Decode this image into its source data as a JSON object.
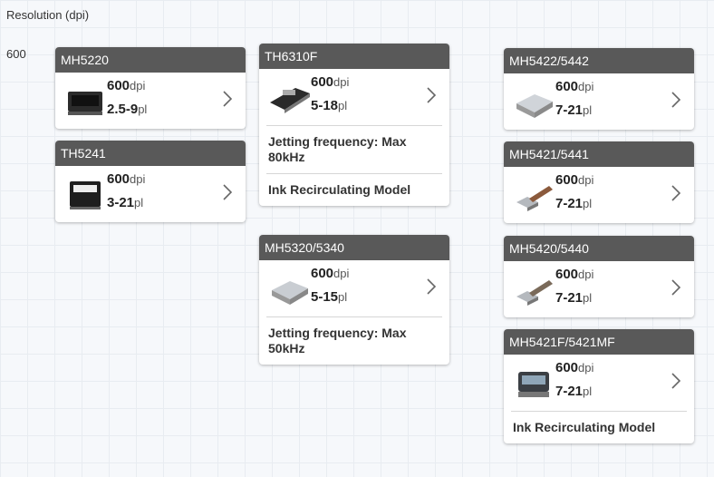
{
  "axis_title": "Resolution (dpi)",
  "row_label": "600",
  "cards": [
    {
      "model": "MH5220",
      "dpi": "600",
      "dpi_unit": "dpi",
      "drop": "2.5-9",
      "drop_unit": "pl",
      "icon": "printhead-black-icon",
      "features": []
    },
    {
      "model": "TH5241",
      "dpi": "600",
      "dpi_unit": "dpi",
      "drop": "3-21",
      "drop_unit": "pl",
      "icon": "printhead-box-icon",
      "features": []
    },
    {
      "model": "TH6310F",
      "dpi": "600",
      "dpi_unit": "dpi",
      "drop": "5-18",
      "drop_unit": "pl",
      "icon": "printhead-wide-icon",
      "features": [
        "Jetting frequency: Max 80kHz",
        "Ink Recirculating Model"
      ]
    },
    {
      "model": "MH5320/5340",
      "dpi": "600",
      "dpi_unit": "dpi",
      "drop": "5-15",
      "drop_unit": "pl",
      "icon": "printhead-silver-icon",
      "features": [
        "Jetting frequency: Max 50kHz"
      ]
    },
    {
      "model": "MH5422/5442",
      "dpi": "600",
      "dpi_unit": "dpi",
      "drop": "7-21",
      "drop_unit": "pl",
      "icon": "printhead-silver-icon",
      "features": []
    },
    {
      "model": "MH5421/5441",
      "dpi": "600",
      "dpi_unit": "dpi",
      "drop": "7-21",
      "drop_unit": "pl",
      "icon": "printhead-cable-icon",
      "features": []
    },
    {
      "model": "MH5420/5440",
      "dpi": "600",
      "dpi_unit": "dpi",
      "drop": "7-21",
      "drop_unit": "pl",
      "icon": "printhead-cable-icon",
      "features": []
    },
    {
      "model": "MH5421F/5421MF",
      "dpi": "600",
      "dpi_unit": "dpi",
      "drop": "7-21",
      "drop_unit": "pl",
      "icon": "printhead-dark-icon",
      "features": [
        "Ink Recirculating Model"
      ]
    }
  ]
}
